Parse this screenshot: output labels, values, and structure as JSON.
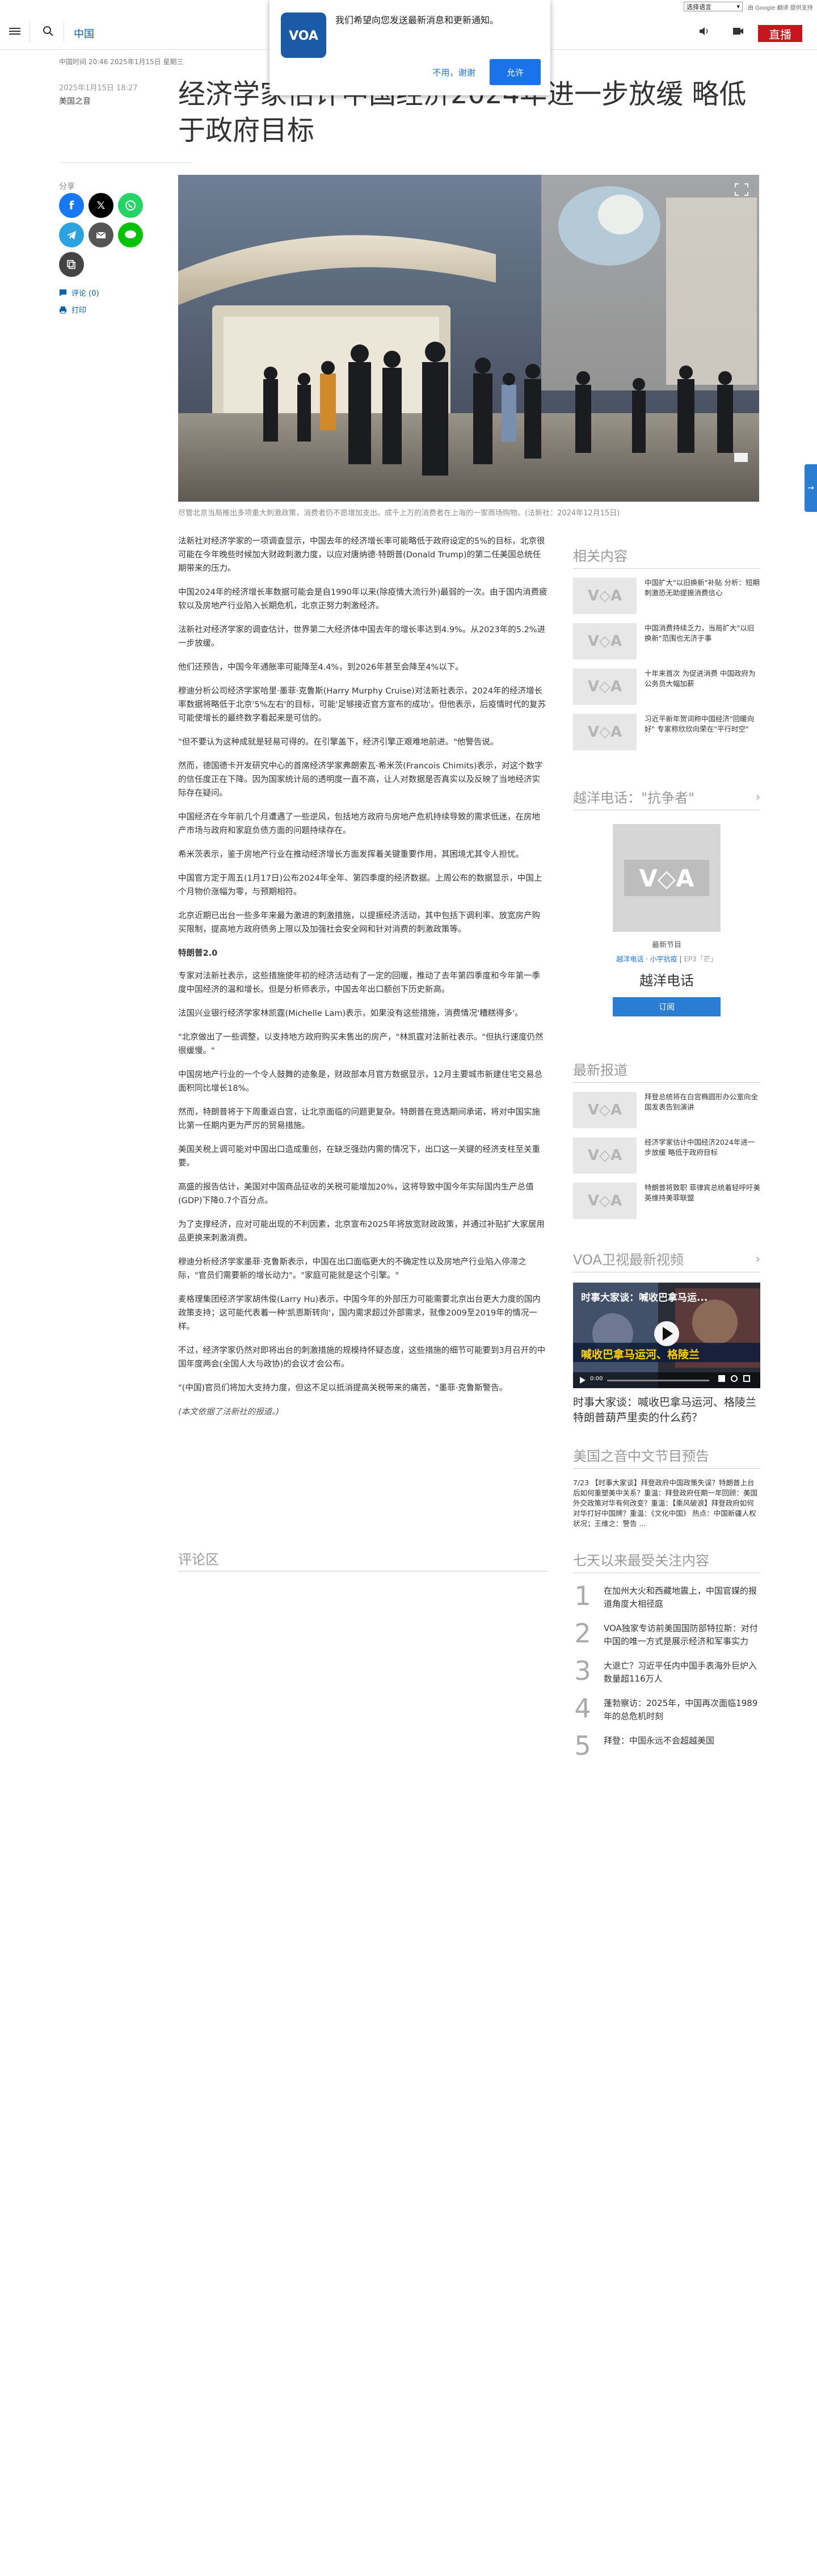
{
  "util": {
    "language_select": "选择语言",
    "google_badge": "由 Google 翻译 提供支持"
  },
  "header": {
    "brand": "中国",
    "live_label": "直播"
  },
  "notification": {
    "message": "我们希望向您发送最新消息和更新通知。",
    "decline": "不用，谢谢",
    "accept": "允许",
    "logo_text": "VOA"
  },
  "article": {
    "meta_top": "中国时间 20:46 2025年1月15日 星期三",
    "pub_date": "2025年1月15日 18:27",
    "author": "美国之音",
    "title": "经济学家估计中国经济2024年进一步放缓 略低于政府目标",
    "caption": "尽管北京当局推出多项重大刺激政策，消费者仍不愿增加支出。成千上万的消费者在上海的一家商场购物。(法新社：2024年12月15日)",
    "paragraphs": [
      "法新社对经济学家的一项调查显示，中国去年的经济增长率可能略低于政府设定的5%的目标，北京很可能在今年晚些时候加大财政刺激力度，以应对唐纳德·特朗普(Donald Trump)的第二任美国总统任期带来的压力。",
      "中国2024年的经济增长率数据可能会是自1990年以来(除疫情大流行外)最弱的一次。由于国内消费疲软以及房地产行业陷入长期危机，北京正努力刺激经济。",
      "法新社对经济学家的调查估计，世界第二大经济体中国去年的增长率达到4.9%。从2023年的5.2%进一步放缓。",
      "他们还预告，中国今年通胀率可能降至4.4%，到2026年甚至会降至4%以下。",
      "穆迪分析公司经济学家哈里·墨菲·克鲁斯(Harry Murphy Cruise)对法新社表示，2024年的经济增长率数据将略低于北京'5%左右'的目标，可能'足够接近官方宣布的成功'。但他表示，后疫情时代的复苏可能使增长的最终数字看起来是可信的。",
      "\"但不要认为这种成就是轻易可得的。在引擎盖下，经济引擎正艰难地前进。\"他警告说。",
      "然而，德国德卡开发研究中心的首席经济学家弗朗索瓦·希米茨(Francois Chimits)表示，对这个数字的信任度正在下降。因为国家统计局的透明度一直不高，让人对数据是否真实以及反映了当地经济实际存在疑问。",
      "中国经济在今年前几个月遭遇了一些逆风，包括地方政府与房地产危机持续导致的需求低迷，在房地产市场与政府和家庭负债方面的问题持续存在。",
      "希米茨表示，鉴于房地产行业在推动经济增长方面发挥着关键重要作用，其困境尤其令人担忧。",
      "中国官方定于周五(1月17日)公布2024年全年、第四季度的经济数据。上周公布的数据显示，中国上个月物价涨幅为零，与预期相符。",
      "北京近期已出台一些多年来最为激进的刺激措施，以提振经济活动，其中包括下调利率、放宽房产购买限制，提高地方政府债务上限以及加强社会安全网和针对消费的刺激政策等。",
      "特朗普2.0",
      "专家对法新社表示，这些措施使年初的经济活动有了一定的回暖，推动了去年第四季度和今年第一季度中国经济的温和增长。但是分析师表示，中国去年出口额创下历史新高。",
      "法国兴业银行经济学家林凯霆(Michelle Lam)表示，如果没有这些措施，消费情况'糟糕得多'。",
      "\"北京做出了一些调整，以支持地方政府购买未售出的房产，\"林凯霆对法新社表示。\"但执行速度仍然很缓慢。\"",
      "中国房地产行业的一个令人鼓舞的迹象是，财政部本月官方数据显示，12月主要城市新建住宅交易总面积同比增长18%。",
      "然而，特朗普将于下周重返白宫，让北京面临的问题更复杂。特朗普在竞选期间承诺，将对中国实施比第一任期内更为严厉的贸易措施。",
      "美国关税上调可能对中国出口造成重创，在缺乏强劲内需的情况下，出口这一关键的经济支柱至关重要。",
      "高盛的报告估计，美国对中国商品征收的关税可能增加20%，这将导致中国今年实际国内生产总值(GDP)下降0.7个百分点。",
      "为了支撑经济，应对可能出现的不利因素，北京宣布2025年将放宽财政政策，并通过补贴扩大家居用品更换来刺激消费。",
      "穆迪分析经济学家墨菲·克鲁斯表示，中国在出口面临更大的不确定性以及房地产行业陷入停滞之际，\"官员们需要新的增长动力\"。\"家庭可能就是这个引擎。\"",
      "麦格理集团经济学家胡伟俊(Larry Hu)表示，中国今年的外部压力可能需要北京出台更大力度的国内政策支持；这可能代表着一种'凯恩斯转向'，国内需求超过外部需求，就像2009至2019年的情况一样。",
      "不过，经济学家仍然对即将出台的刺激措施的规模持怀疑态度，这些措施的细节可能要到3月召开的中国年度两会(全国人大与政协)的会议才会公布。",
      "\"(中国)官员们将加大支持力度，但这不足以抵消提高关税带来的痛苦，\"墨菲·克鲁斯警告。",
      "(本文依据了法新社的报道。)"
    ],
    "comments_heading": "评论区"
  },
  "share": {
    "label": "分享",
    "comments_link": "评论 (0)",
    "print_link": "打印"
  },
  "sidebar": {
    "related": {
      "heading": "相关内容",
      "items": [
        "中国扩大\"以旧换新\"补贴 分析：短期刺激恐无助提振消费信心",
        "中国消费持续乏力，当局扩大\"以旧换新\"范围也无济于事",
        "十年来首次 为促进消费 中国政府为公务员大幅加薪",
        "习近平新年贺词称中国经济\"回暖向好\" 专家称欣欣向荣在\"平行时空\""
      ]
    },
    "podcast": {
      "heading": "越洋电话：\"抗争者\"",
      "label": "最新节目",
      "links": "越洋电话 · 小宇抗疫",
      "links_extra": "EP3「芒」",
      "title": "越洋电话",
      "subscribe": "订阅"
    },
    "latest": {
      "heading": "最新报道",
      "items": [
        "拜登总统将在白宫椭圆形办公室向全国发表告别演讲",
        "经济学家估计中国经济2024年进一步放缓 略低于政府目标",
        "特朗普将致职 菲律宾总统着轻呼吁美英维持美菲联盟"
      ]
    },
    "video": {
      "heading": "VOA卫视最新视频",
      "overlay_top": "时事大家谈：喊收巴拿马运...",
      "overlay_main": "喊收巴拿马运河、格陵兰",
      "time": "0:00",
      "title": "时事大家谈：喊收巴拿马运河、格陵兰 特朗普葫芦里卖的什么药？"
    },
    "schedule": {
      "heading": "美国之音中文节目预告",
      "text": "7/23 【时事大家谈】拜登政府中国政策失误？特朗普上台后如何重塑美中关系？重温：拜登政府任期一年回顾：美国外交政策对华有何改变？重温：【乘风破浪】拜登政府如何对华打好中国牌？重温：《文化中国》 热点：中国新疆人权状况；王维之：警告 ..."
    },
    "popular": {
      "heading": "七天以来最受关注内容",
      "items": [
        {
          "num": "1",
          "text": "在加州大火和西藏地震上，中国官媒的报道角度大相径庭"
        },
        {
          "num": "2",
          "text": "VOA独家专访前美国国防部特拉斯：对付中国的唯一方式是展示经济和军事实力"
        },
        {
          "num": "3",
          "text": "大退亡？习近平任内中国手表海外巨炉入数量超116万人"
        },
        {
          "num": "4",
          "text": "蓬勃察访：2025年，中国再次面临1989年的总危机时刻"
        },
        {
          "num": "5",
          "text": "拜登：中国永远不会超越美国"
        }
      ]
    }
  },
  "colors": {
    "live_red": "#c4161c",
    "accent_blue": "#0162b1",
    "button_blue": "#1a73e8"
  }
}
